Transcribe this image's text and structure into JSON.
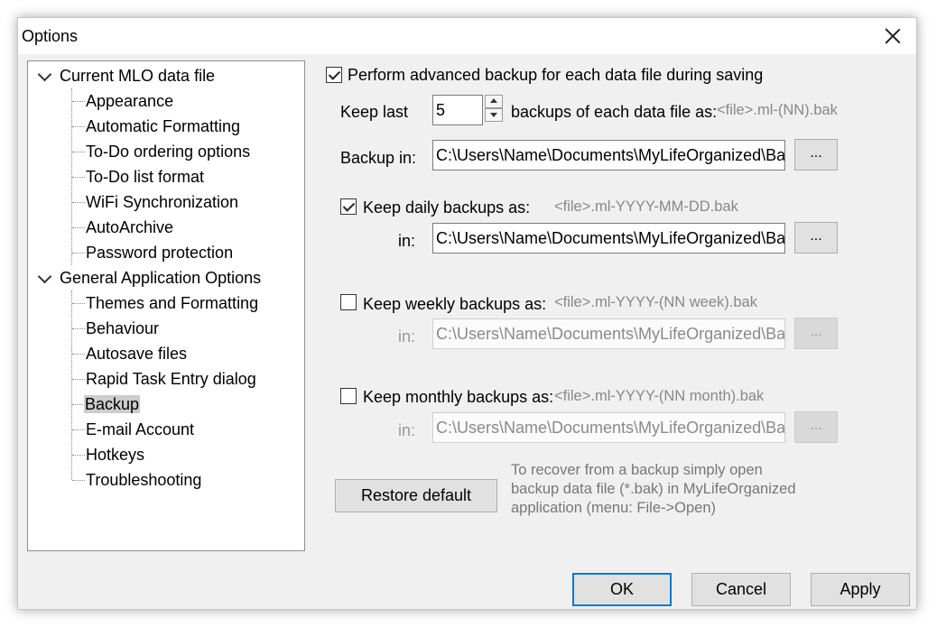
{
  "window": {
    "title": "Options"
  },
  "tree": {
    "groups": [
      {
        "label": "Current MLO data file",
        "items": [
          "Appearance",
          "Automatic Formatting",
          "To-Do ordering options",
          "To-Do list format",
          "WiFi Synchronization",
          "AutoArchive",
          "Password protection"
        ]
      },
      {
        "label": "General Application Options",
        "items": [
          "Themes and Formatting",
          "Behaviour",
          "Autosave files",
          "Rapid Task Entry dialog",
          "Backup",
          "E-mail Account",
          "Hotkeys",
          "Troubleshooting"
        ]
      }
    ],
    "selected": "Backup"
  },
  "backup": {
    "perform_label": "Perform advanced backup for each data file during saving",
    "perform_checked": true,
    "keep_last_label": "Keep last",
    "keep_last_value": "5",
    "backups_label": "backups of each data file as:",
    "backups_pattern": "<file>.ml-(NN).bak",
    "backup_in_label": "Backup in:",
    "backup_in_path": "C:\\Users\\Name\\Documents\\MyLifeOrganized\\Ba",
    "browse_label": "...",
    "daily": {
      "label": "Keep daily backups as:",
      "pattern": "<file>.ml-YYYY-MM-DD.bak",
      "checked": true,
      "in_label": "in:",
      "path": "C:\\Users\\Name\\Documents\\MyLifeOrganized\\Ba"
    },
    "weekly": {
      "label": "Keep weekly backups as:",
      "pattern": "<file>.ml-YYYY-(NN week).bak",
      "checked": false,
      "in_label": "in:",
      "path": "C:\\Users\\Name\\Documents\\MyLifeOrganized\\Ba"
    },
    "monthly": {
      "label": "Keep monthly backups as:",
      "pattern": "<file>.ml-YYYY-(NN month).bak",
      "checked": false,
      "in_label": "in:",
      "path": "C:\\Users\\Name\\Documents\\MyLifeOrganized\\Ba"
    },
    "restore_label": "Restore default",
    "info_lines": [
      "To recover from a backup simply open",
      "backup data file (*.bak) in MyLifeOrganized",
      "application (menu: File->Open)"
    ]
  },
  "footer": {
    "ok_label": "OK",
    "cancel_label": "Cancel",
    "apply_label": "Apply"
  },
  "colors": {
    "accent": "#0078d7",
    "selection": "#cccccc",
    "dialog_bg": "#f0f0f0"
  }
}
